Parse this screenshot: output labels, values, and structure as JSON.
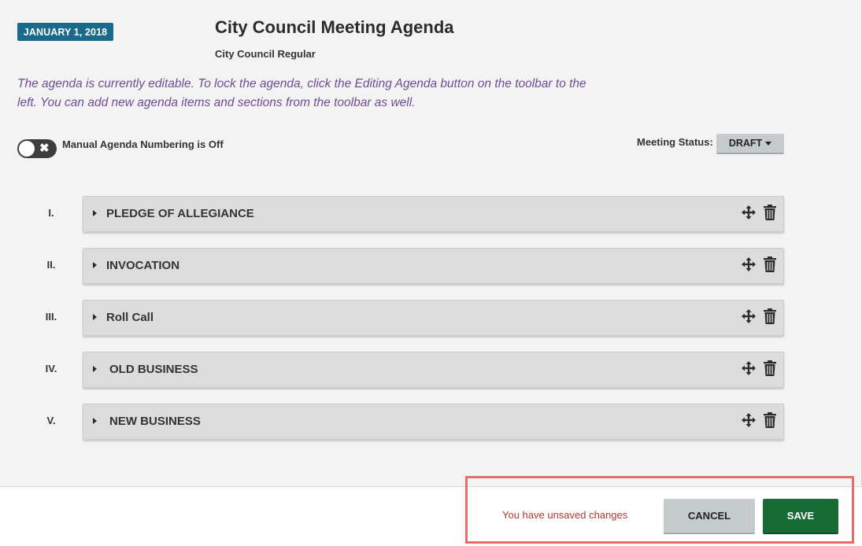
{
  "header": {
    "date": "JANUARY 1, 2018",
    "title": "City Council Meeting Agenda",
    "subtitle": "City Council Regular"
  },
  "notice": "The agenda is currently editable. To lock the agenda, click the Editing Agenda button on the toolbar to the left. You can add new agenda items and sections from the toolbar as well.",
  "numbering_toggle": {
    "label": "Manual Agenda Numbering is Off",
    "state": "off",
    "icon": "close-icon"
  },
  "meeting_status": {
    "label": "Meeting Status:",
    "value": "DRAFT"
  },
  "agenda_items": [
    {
      "numeral": "I.",
      "title": "PLEDGE OF ALLEGIANCE"
    },
    {
      "numeral": "II.",
      "title": "INVOCATION"
    },
    {
      "numeral": "III.",
      "title": "Roll Call"
    },
    {
      "numeral": "IV.",
      "title": "OLD BUSINESS"
    },
    {
      "numeral": "V.",
      "title": "NEW BUSINESS"
    }
  ],
  "footer": {
    "unsaved_message": "You have unsaved changes",
    "cancel_label": "CANCEL",
    "save_label": "SAVE"
  },
  "colors": {
    "date_badge": "#1b6a8c",
    "notice_text": "#6f4c97",
    "save_button": "#176c36",
    "unsaved_text": "#b03a35",
    "highlight_frame": "#e46e66"
  }
}
